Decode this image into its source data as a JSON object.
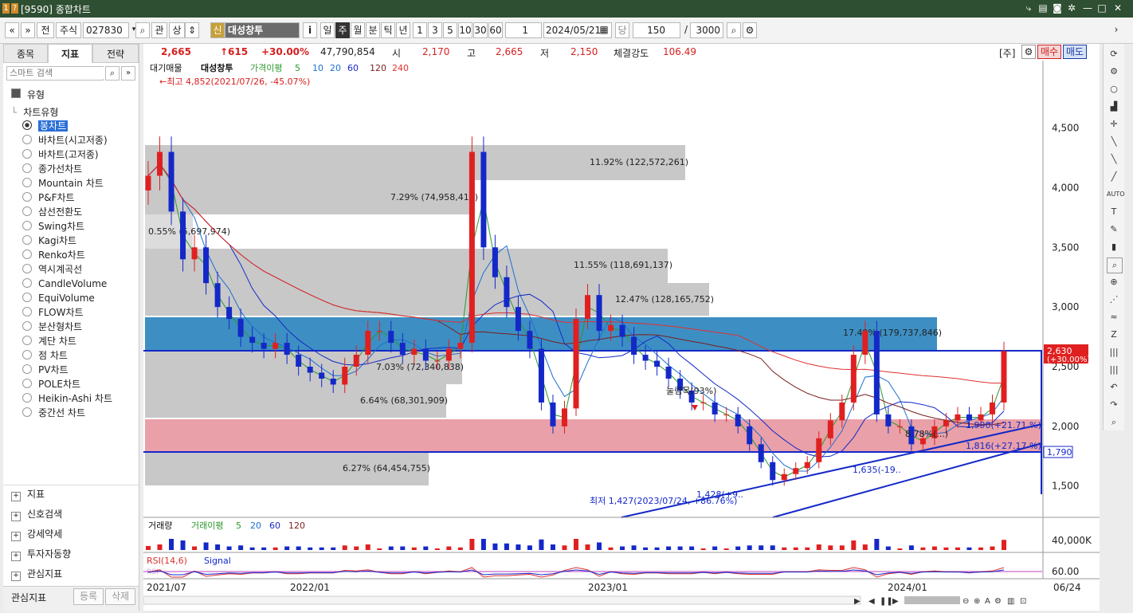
{
  "window": {
    "title": "[9590] 종합차트"
  },
  "toolbar": {
    "market": "주식",
    "code": "027830",
    "rel": "관",
    "up": "상",
    "credit": "신",
    "name": "대성창투",
    "info_btn": "i",
    "periods": [
      "일",
      "주",
      "월",
      "분",
      "틱",
      "년"
    ],
    "active_period": "주",
    "minutes": [
      "1",
      "3",
      "5",
      "10",
      "30",
      "60"
    ],
    "count_spin": "1",
    "date": "2024/05/21",
    "dang": "당",
    "count": "150",
    "slash": "/",
    "total": "3000"
  },
  "left": {
    "tabs": [
      "종목",
      "지표",
      "전략"
    ],
    "active_tab": "지표",
    "search_placeholder": "스마트 검색",
    "group_label": "유형",
    "subgroup": "차트유형",
    "chart_types": [
      "봉차트",
      "바차트(시고저종)",
      "바차트(고저종)",
      "종가선차트",
      "Mountain 차트",
      "P&F차트",
      "삼선전환도",
      "Swing차트",
      "Kagi차트",
      "Renko차트",
      "역시계곡선",
      "CandleVolume",
      "EquiVolume",
      "FLOW차트",
      "분산형차트",
      "계단 차트",
      "점 차트",
      "PV차트",
      "POLE차트",
      "Heikin-Ashi 차트",
      "중간선 차트"
    ],
    "selected_type": "봉차트",
    "sections": [
      "지표",
      "신호검색",
      "강세약세",
      "투자자동향",
      "관심지표"
    ],
    "bottom_label": "관심지표",
    "btn_register": "등록",
    "btn_delete": "삭제"
  },
  "infobar": {
    "price": "2,665",
    "change": "↑615",
    "rate": "+30.00%",
    "volume": "47,790,854",
    "open_label": "시",
    "open": "2,170",
    "high_label": "고",
    "high": "2,665",
    "low_label": "저",
    "low": "2,150",
    "strength_label": "체결강도",
    "strength": "106.49",
    "unit": "[주]",
    "buy": "매수",
    "sell": "매도"
  },
  "legend": {
    "main": "대기매물",
    "name": "대성창투",
    "ma_label": "가격이평",
    "ma": [
      "5",
      "10",
      "20",
      "60",
      "120",
      "240"
    ],
    "vol_label": "거래량",
    "vol_ma_label": "거래이평",
    "vol_ma": [
      "5",
      "20",
      "60",
      "120"
    ],
    "rsi_label": "RSI(14,6)",
    "signal_label": "Signal",
    "rsi_badge": "RSI"
  },
  "annotations": {
    "high_note": "←최고 4,852(2021/07/26, -45.07%)",
    "low_note": "최저 1,427(2023/07/24, +86.76%)",
    "low_marker": "1,428(+9..",
    "pullback": "눌림목(93%)",
    "support1": "1,990(+21.71 %)",
    "support2": "1,816(+27.17 %)",
    "trend_pt": "1,635(-19..",
    "band_mid": "8.78%(...)",
    "last_price_tag": "2,630",
    "last_price_rate": "(+30.00%)",
    "hline_tag": "1,790"
  },
  "volume_profile": [
    {
      "label": "11.92% (122,572,261)"
    },
    {
      "label": "7.29% (74,958,414)"
    },
    {
      "label": "0.55% (5,697,974)"
    },
    {
      "label": "11.55% (118,691,137)"
    },
    {
      "label": "12.47% (128,165,752)"
    },
    {
      "label": "17.49% (179,737,846)"
    },
    {
      "label": "7.03% (72,340,838)"
    },
    {
      "label": "6.64% (68,301,909)"
    },
    {
      "label": "6.27% (64,454,755)"
    }
  ],
  "chart_data": {
    "type": "candlestick",
    "y_ticks": [
      "4,500",
      "4,000",
      "3,500",
      "3,000",
      "2,500",
      "2,000",
      "1,500"
    ],
    "vol_tick": "40,000K",
    "rsi_tick": "60.00",
    "x_ticks": [
      "2021/07",
      "2022/01",
      "2023/01",
      "2024/01",
      "06/24"
    ],
    "series": [
      {
        "name": "주봉",
        "values": [
          4100,
          4300,
          3800,
          3400,
          3500,
          3200,
          3000,
          2900,
          2750,
          2700,
          2650,
          2700,
          2600,
          2500,
          2450,
          2400,
          2350,
          2500,
          2600,
          2800,
          2800,
          2700,
          2600,
          2650,
          2550,
          2550,
          2650,
          2700,
          4300,
          3500,
          3250,
          3000,
          2800,
          2650,
          2200,
          2000,
          2150,
          2900,
          3100,
          2800,
          2850,
          2750,
          2600,
          2550,
          2500,
          2400,
          2300,
          2200,
          2200,
          2100,
          2100,
          2000,
          1850,
          1700,
          1550,
          1600,
          1650,
          1700,
          1900,
          2050,
          2200,
          2600,
          2800,
          2100,
          2000,
          2000,
          1850,
          1900,
          2000,
          2050,
          2100,
          2050,
          2100,
          2200,
          2630
        ]
      }
    ],
    "colors": {
      "up": "#e02020",
      "down": "#1428c8",
      "ma5": "#2a9a2a",
      "ma10": "#1c6fd1",
      "ma20": "#1428c8",
      "ma120": "#7a1f1f",
      "ma240": "#e03030"
    }
  }
}
